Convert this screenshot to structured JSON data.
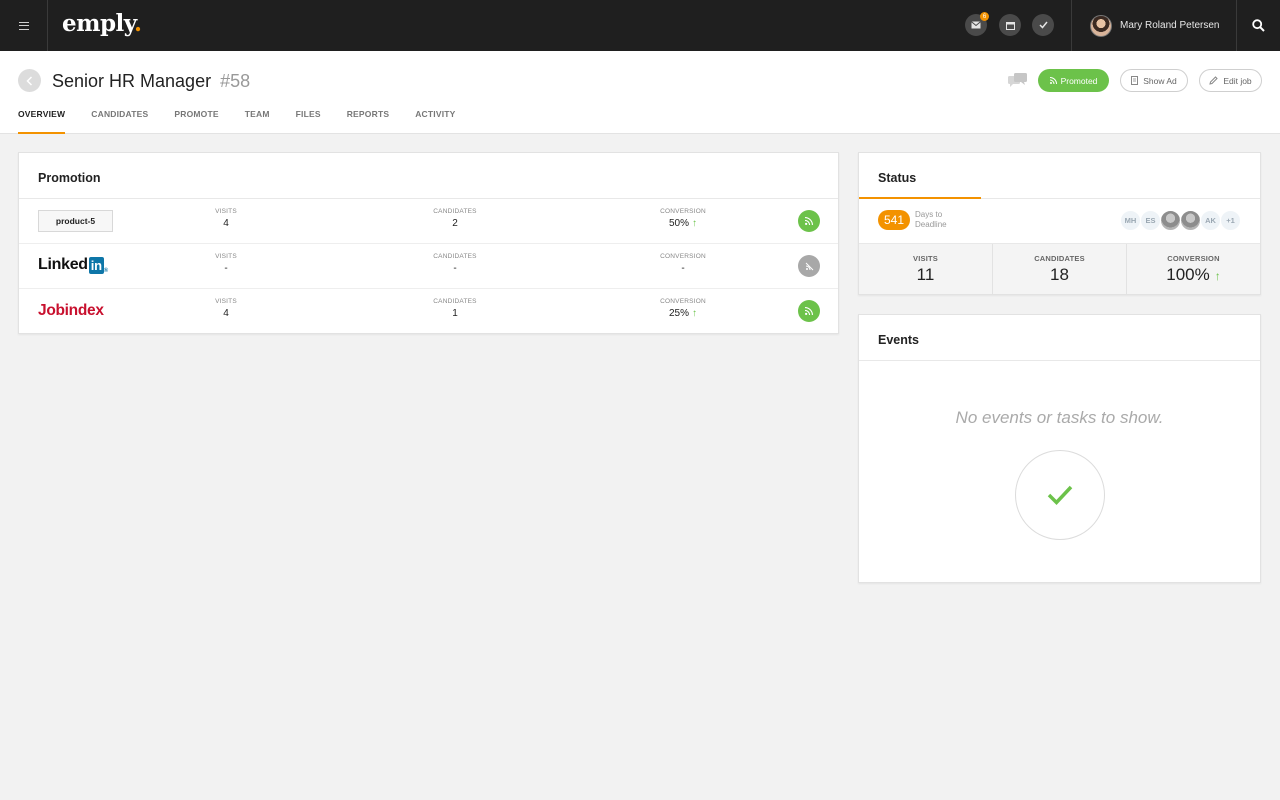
{
  "app": {
    "logo_text": "emply",
    "logo_dot": ".",
    "user_name": "Mary Roland Petersen",
    "mail_badge": "6",
    "accent": "#f39200",
    "success": "#6cc24a"
  },
  "job": {
    "title": "Senior HR Manager",
    "id": "#58",
    "buttons": {
      "promoted": "Promoted",
      "show_ad": "Show Ad",
      "edit_job": "Edit job"
    },
    "tabs": [
      "OVERVIEW",
      "CANDIDATES",
      "PROMOTE",
      "TEAM",
      "FILES",
      "REPORTS",
      "ACTIVITY"
    ]
  },
  "promotion": {
    "title": "Promotion",
    "labels": {
      "visits": "VISITS",
      "candidates": "CANDIDATES",
      "conversion": "CONVERSION"
    },
    "rows": [
      {
        "channel": "product-5",
        "visits": "4",
        "candidates": "2",
        "conversion": "50%",
        "trend": "up",
        "status": "active"
      },
      {
        "channel": "LinkedIn",
        "visits": "-",
        "candidates": "-",
        "conversion": "-",
        "trend": "",
        "status": "inactive"
      },
      {
        "channel": "Jobindex",
        "visits": "4",
        "candidates": "1",
        "conversion": "25%",
        "trend": "up",
        "status": "active"
      }
    ],
    "linkedin_word": "Linked",
    "linkedin_in": "in",
    "linkedin_reg": "®"
  },
  "status": {
    "title": "Status",
    "days": "541",
    "days_label_1": "Days to",
    "days_label_2": "Deadline",
    "team": [
      "MH",
      "ES",
      "",
      "",
      "AK",
      "+1"
    ],
    "stats": [
      {
        "label": "VISITS",
        "value": "11"
      },
      {
        "label": "CANDIDATES",
        "value": "18"
      },
      {
        "label": "CONVERSION",
        "value": "100%"
      }
    ]
  },
  "events": {
    "title": "Events",
    "empty_message": "No events or tasks to show."
  }
}
